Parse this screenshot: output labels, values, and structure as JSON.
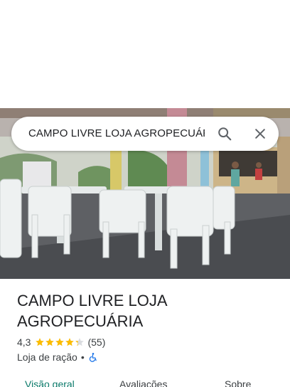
{
  "search": {
    "query": "CAMPO LIVRE LOJA AGROPECUÁRIA",
    "search_icon": "search-icon",
    "close_icon": "close-icon"
  },
  "photo": {
    "subject": "covered patio with white plastic chairs and tables"
  },
  "place": {
    "name": "CAMPO LIVRE LOJA AGROPECUÁRIA",
    "rating": "4,3",
    "rating_value": 4.3,
    "rating_max": 5,
    "review_count": "(55)",
    "category": "Loja de ração",
    "separator": "•",
    "accessibility_icon": "wheelchair-icon"
  },
  "tabs": [
    {
      "label": "Visão geral",
      "active": true
    },
    {
      "label": "Avaliações",
      "active": false
    },
    {
      "label": "Sobre",
      "active": false
    }
  ],
  "colors": {
    "star": "#fbbc04",
    "active_tab": "#0b7a6a",
    "accessibility": "#1a73e8",
    "text_primary": "#202124",
    "text_secondary": "#3c4043"
  }
}
